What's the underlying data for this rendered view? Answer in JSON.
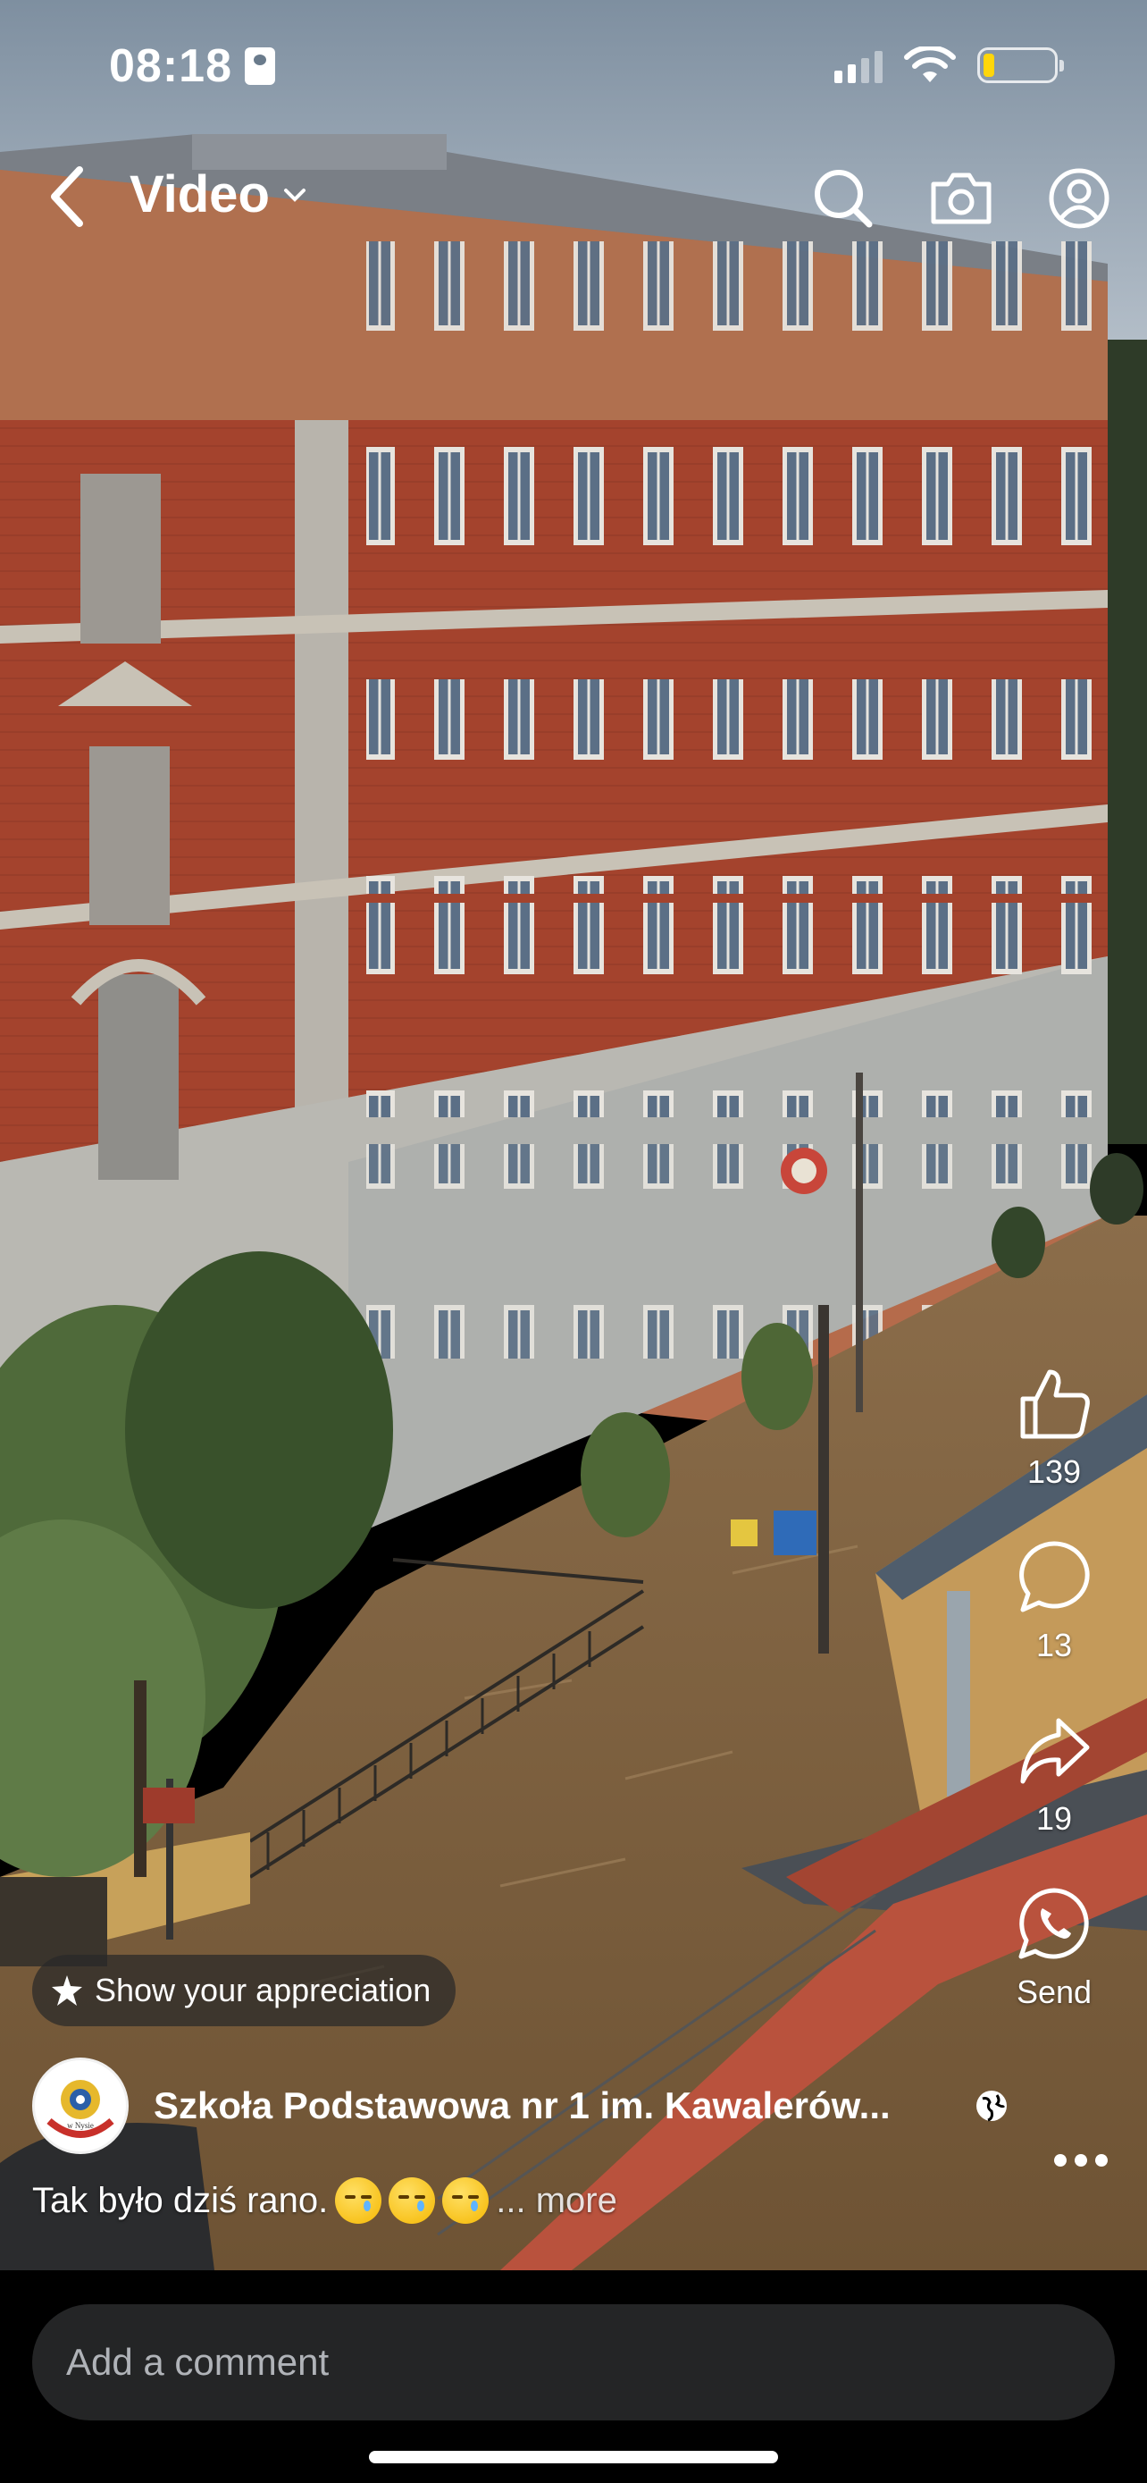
{
  "status_bar": {
    "time": "08:18"
  },
  "nav": {
    "title": "Video",
    "icons": [
      "back-icon",
      "chevron-down-icon",
      "search-icon",
      "camera-icon",
      "profile-icon"
    ]
  },
  "actions": {
    "like_count": "139",
    "comment_count": "13",
    "share_count": "19",
    "send_label": "Send"
  },
  "appreciation": {
    "label": "Show your appreciation"
  },
  "post": {
    "author": "Szkoła Podstawowa nr 1 im. Kawalerów...",
    "caption": "Tak było dziś rano.",
    "more_label": "... more",
    "emojis": [
      "crying-face",
      "crying-face",
      "crying-face"
    ],
    "avatar_text": "w Nysie"
  },
  "comment": {
    "placeholder": "Add a comment"
  },
  "colors": {
    "background": "#000000",
    "input_bg": "#242526",
    "placeholder": "#b0b3b8",
    "battery": "#ffd60a",
    "flood_water": "#8a6a45",
    "brick": "#a6442e"
  }
}
